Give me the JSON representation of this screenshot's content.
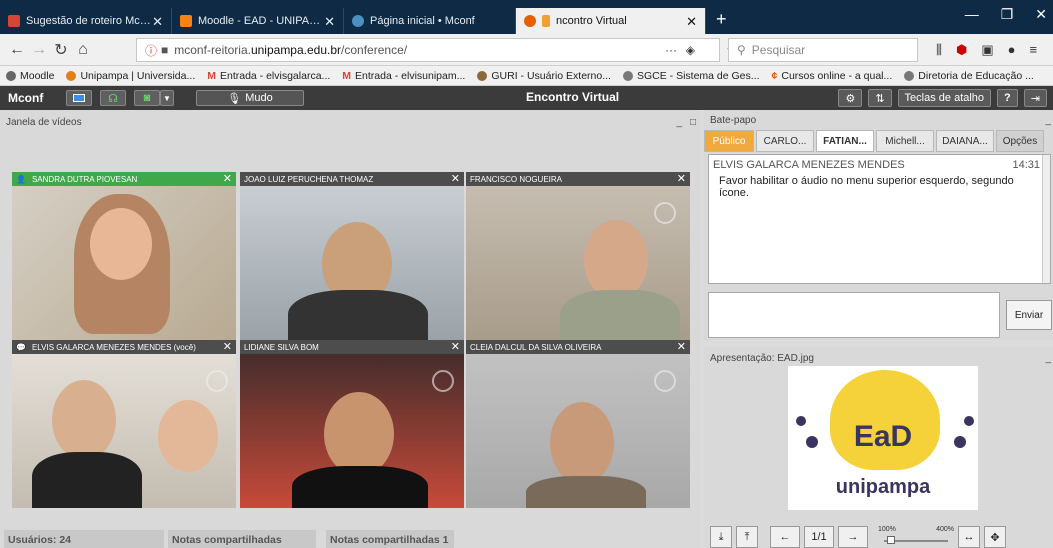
{
  "browser": {
    "tabs": [
      {
        "title": "Sugestão de roteiro Mconf de E",
        "icon": "gmail-icon",
        "color": "#d44638"
      },
      {
        "title": "Moodle - EAD - UNIPAMPA",
        "icon": "moodle-icon",
        "color": "#f98012"
      },
      {
        "title": "Página inicial • Mconf",
        "icon": "mconf-icon",
        "color": "#4a90c2"
      },
      {
        "title": "ncontro Virtual",
        "icon": "firefox-icon",
        "color": "#e66000"
      }
    ],
    "url_prefix": "mconf-reitoria.",
    "url_domain": "unipampa.edu.br",
    "url_path": "/conference/",
    "search_placeholder": "Pesquisar",
    "bookmarks": [
      "Moodle",
      "Unipampa | Universida...",
      "Entrada - elvisgalarca...",
      "Entrada - elvisunipam...",
      "GURI - Usuário Externo...",
      "SGCE - Sistema de Ges...",
      "Cursos online - a qual...",
      "Diretoria de Educação ..."
    ]
  },
  "mconf": {
    "logo": "Mconf",
    "mute_label": "Mudo",
    "title": "Encontro Virtual",
    "shortcuts_label": "Teclas de atalho",
    "help_label": "?"
  },
  "video": {
    "panel_title": "Janela de vídeos",
    "tiles": [
      {
        "name": "SANDRA DUTRA PIOVESAN"
      },
      {
        "name": "JOAO LUIZ PERUCHENA THOMAZ"
      },
      {
        "name": "FRANCISCO NOGUEIRA"
      },
      {
        "name": "ELVIS GALARCA MENEZES MENDES (você)"
      },
      {
        "name": "LIDIANE SILVA BOM"
      },
      {
        "name": "CLEIA DALCUL DA SILVA OLIVEIRA"
      }
    ]
  },
  "chat": {
    "panel_title": "Bate-papo",
    "tabs": [
      "Público",
      "CARLO...",
      "FATIAN...",
      "Michell...",
      "DAIANA...",
      "Opções"
    ],
    "message_from": "ELVIS GALARCA MENEZES MENDES",
    "message_time": "14:31",
    "message_text": "Favor habilitar o áudio no menu superior esquerdo, segundo ícone.",
    "send_label": "Enviar"
  },
  "presentation": {
    "panel_title": "Apresentação: EAD.jpg",
    "slide_text_main": "EaD",
    "slide_text_sub": "unipampa",
    "page": "1/1",
    "zoom_min": "100%",
    "zoom_max": "400%",
    "zoom_value": 0.05
  },
  "footer": {
    "users": "Usuários: 24",
    "notes": "Notas compartilhadas",
    "notes1": "Notas compartilhadas 1"
  }
}
